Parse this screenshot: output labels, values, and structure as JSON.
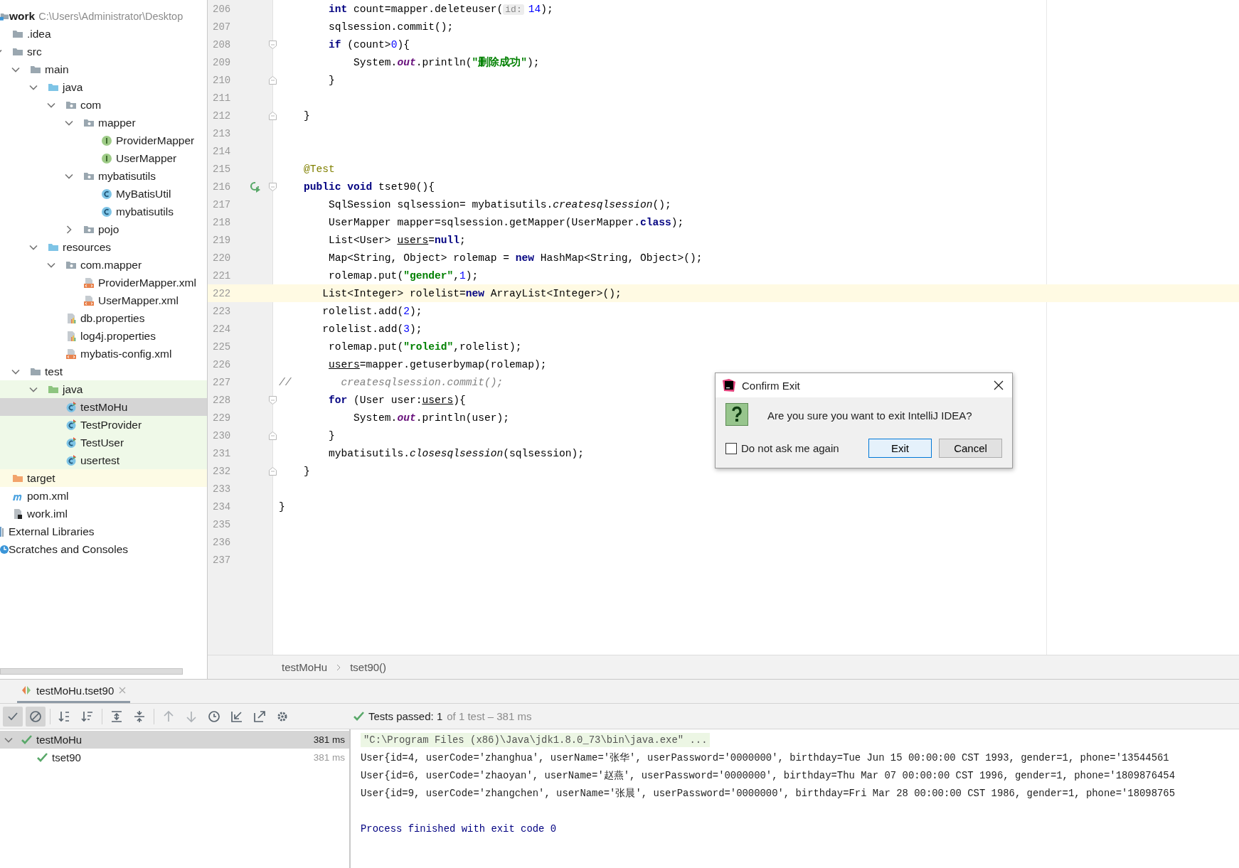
{
  "project": {
    "root": {
      "label": "work",
      "path": "C:\\Users\\Administrator\\Desktop",
      "kind": "module"
    },
    "tree": [
      {
        "label": ".idea",
        "kind": "folder",
        "excluded": false
      },
      {
        "label": "src",
        "kind": "folder",
        "excluded": false,
        "expanded": true,
        "children": [
          {
            "label": "main",
            "kind": "folder",
            "expanded": true,
            "children": [
              {
                "label": "java",
                "kind": "source-folder",
                "expanded": true,
                "children": [
                  {
                    "label": "com",
                    "kind": "package",
                    "expanded": true,
                    "children": [
                      {
                        "label": "mapper",
                        "kind": "package",
                        "expanded": true,
                        "children": [
                          {
                            "label": "ProviderMapper",
                            "kind": "interface"
                          },
                          {
                            "label": "UserMapper",
                            "kind": "interface"
                          }
                        ]
                      },
                      {
                        "label": "mybatisutils",
                        "kind": "package",
                        "expanded": true,
                        "children": [
                          {
                            "label": "MyBatisUtil",
                            "kind": "class"
                          },
                          {
                            "label": "mybatisutils",
                            "kind": "class"
                          }
                        ]
                      },
                      {
                        "label": "pojo",
                        "kind": "package",
                        "expanded": false
                      }
                    ]
                  }
                ]
              },
              {
                "label": "resources",
                "kind": "resources-folder",
                "expanded": true,
                "children": [
                  {
                    "label": "com.mapper",
                    "kind": "package",
                    "expanded": true,
                    "children": [
                      {
                        "label": "ProviderMapper.xml",
                        "kind": "xml"
                      },
                      {
                        "label": "UserMapper.xml",
                        "kind": "xml"
                      }
                    ]
                  },
                  {
                    "label": "db.properties",
                    "kind": "properties"
                  },
                  {
                    "label": "log4j.properties",
                    "kind": "properties"
                  },
                  {
                    "label": "mybatis-config.xml",
                    "kind": "xml"
                  }
                ]
              }
            ]
          },
          {
            "label": "test",
            "kind": "folder",
            "expanded": true,
            "children": [
              {
                "label": "java",
                "kind": "test-folder",
                "test_scope": true,
                "expanded": true,
                "children": [
                  {
                    "label": "testMoHu",
                    "kind": "test-class",
                    "test_scope": true,
                    "selected": true
                  },
                  {
                    "label": "TestProvider",
                    "kind": "test-class",
                    "test_scope": true,
                    "selected": false
                  },
                  {
                    "label": "TestUser",
                    "kind": "test-class",
                    "test_scope": true,
                    "selected": false
                  },
                  {
                    "label": "usertest",
                    "kind": "test-class",
                    "test_scope": true,
                    "selected": false
                  }
                ]
              }
            ]
          }
        ]
      },
      {
        "label": "target",
        "kind": "excluded-folder",
        "excluded": true
      },
      {
        "label": "pom.xml",
        "kind": "maven",
        "excluded": false
      },
      {
        "label": "work.iml",
        "kind": "iml",
        "excluded": false
      }
    ],
    "extras": [
      {
        "label": "External Libraries",
        "kind": "libraries"
      },
      {
        "label": "Scratches and Consoles",
        "kind": "scratches"
      }
    ]
  },
  "editor": {
    "lines": [
      {
        "number": "206",
        "kind": "body",
        "tokens": [
          {
            "keyword": "int"
          },
          {
            "text": " count=mapper.deleteuser("
          },
          {
            "hint": "id:"
          },
          {
            "number": "14"
          },
          {
            "text": ");"
          }
        ]
      },
      {
        "number": "207",
        "kind": "body",
        "tokens": [
          {
            "text": "sqlsession.commit();"
          }
        ]
      },
      {
        "number": "208",
        "kind": "body",
        "fold_start": true,
        "tokens": [
          {
            "keyword": "if"
          },
          {
            "text": " (count>"
          },
          {
            "number": "0"
          },
          {
            "text": "){"
          }
        ]
      },
      {
        "number": "209",
        "kind": "inner",
        "tokens": [
          {
            "text": "System."
          },
          {
            "static_field": "out"
          },
          {
            "text": ".println("
          },
          {
            "string": "\"删除成功\""
          },
          {
            "text": ");"
          }
        ]
      },
      {
        "number": "210",
        "kind": "body",
        "fold_end": true,
        "tokens": [
          {
            "text": "}"
          }
        ]
      },
      {
        "number": "211"
      },
      {
        "number": "212",
        "kind": "method",
        "fold_end": true,
        "tokens": [
          {
            "text": "}"
          }
        ]
      },
      {
        "number": "213"
      },
      {
        "number": "214"
      },
      {
        "number": "215",
        "kind": "method",
        "tokens": [
          {
            "annotation": "@Test"
          }
        ]
      },
      {
        "number": "216",
        "kind": "method",
        "fold_start": true,
        "run": true,
        "tokens": [
          {
            "keyword": "public void"
          },
          {
            "text": " tset90(){"
          }
        ]
      },
      {
        "number": "217",
        "kind": "body",
        "tokens": [
          {
            "text": "SqlSession sqlsession= mybatisutils."
          },
          {
            "italic": "createsqlsession"
          },
          {
            "text": "();"
          }
        ]
      },
      {
        "number": "218",
        "kind": "body",
        "tokens": [
          {
            "text": "UserMapper mapper=sqlsession.getMapper(UserMapper."
          },
          {
            "keyword": "class"
          },
          {
            "text": ");"
          }
        ]
      },
      {
        "number": "219",
        "kind": "body",
        "tokens": [
          {
            "text": "List<User> "
          },
          {
            "underlined": "users"
          },
          {
            "text": "="
          },
          {
            "keyword": "null"
          },
          {
            "text": ";"
          }
        ]
      },
      {
        "number": "220",
        "kind": "body",
        "tokens": [
          {
            "text": "Map<String, Object> rolemap = "
          },
          {
            "keyword": "new"
          },
          {
            "text": " HashMap<String, Object>();"
          }
        ]
      },
      {
        "number": "221",
        "kind": "body",
        "tokens": [
          {
            "text": "rolemap.put("
          },
          {
            "string": "\"gender\""
          },
          {
            "text": ","
          },
          {
            "number": "1"
          },
          {
            "text": ");"
          }
        ]
      },
      {
        "number": "222",
        "kind": "shifted",
        "current": true,
        "tokens": [
          {
            "text": "List<Integer> rolelist="
          },
          {
            "keyword": "new"
          },
          {
            "text": " ArrayList<Integer>();"
          }
        ]
      },
      {
        "number": "223",
        "kind": "shifted",
        "tokens": [
          {
            "text": "rolelist.add("
          },
          {
            "number": "2"
          },
          {
            "text": ");"
          }
        ]
      },
      {
        "number": "224",
        "kind": "shifted",
        "tokens": [
          {
            "text": "rolelist.add("
          },
          {
            "number": "3"
          },
          {
            "text": ");"
          }
        ]
      },
      {
        "number": "225",
        "kind": "body",
        "tokens": [
          {
            "text": "rolemap.put("
          },
          {
            "string": "\"roleid\""
          },
          {
            "text": ",rolelist);"
          }
        ]
      },
      {
        "number": "226",
        "kind": "body",
        "tokens": [
          {
            "underlined": "users"
          },
          {
            "text": "=mapper.getuserbymap(rolemap);"
          }
        ]
      },
      {
        "number": "227",
        "kind": "flush",
        "tokens": [
          {
            "comment": "//        createsqlsession.commit();"
          }
        ]
      },
      {
        "number": "228",
        "kind": "body",
        "fold_start": true,
        "tokens": [
          {
            "keyword": "for"
          },
          {
            "text": " (User user:"
          },
          {
            "underlined": "users"
          },
          {
            "text": "){"
          }
        ]
      },
      {
        "number": "229",
        "kind": "inner",
        "tokens": [
          {
            "text": "System."
          },
          {
            "static_field": "out"
          },
          {
            "text": ".println(user);"
          }
        ]
      },
      {
        "number": "230",
        "kind": "body",
        "fold_end": true,
        "tokens": [
          {
            "text": "}"
          }
        ]
      },
      {
        "number": "231",
        "kind": "body",
        "tokens": [
          {
            "text": "mybatisutils."
          },
          {
            "italic": "closesqlsession"
          },
          {
            "text": "(sqlsession);"
          }
        ]
      },
      {
        "number": "232",
        "kind": "method",
        "fold_end": true,
        "tokens": [
          {
            "text": "}"
          }
        ]
      },
      {
        "number": "233"
      },
      {
        "number": "234",
        "kind": "flush",
        "tokens": [
          {
            "text": "}"
          }
        ]
      },
      {
        "number": "235"
      },
      {
        "number": "236"
      },
      {
        "number": "237"
      }
    ],
    "breadcrumbs": [
      "testMoHu",
      "tset90()"
    ]
  },
  "dialog": {
    "title": "Confirm Exit",
    "message": "Are you sure you want to exit IntelliJ IDEA?",
    "checkbox": {
      "label": "Do not ask me again",
      "checked": false
    },
    "buttons": [
      {
        "label": "Exit",
        "default": true
      },
      {
        "label": "Cancel",
        "default": false
      }
    ]
  },
  "run": {
    "tab": {
      "label": "testMoHu.tset90",
      "selected": true
    },
    "toolbar": [
      {
        "kind": "check",
        "pressed": true,
        "disabled": false
      },
      {
        "kind": "stop",
        "pressed": true,
        "disabled": false
      },
      {
        "kind": "sort-alpha",
        "pressed": false,
        "disabled": false
      },
      {
        "kind": "sort-duration",
        "pressed": false,
        "disabled": false
      },
      {
        "kind": "expand",
        "pressed": false,
        "disabled": false
      },
      {
        "kind": "collapse",
        "pressed": false,
        "disabled": false
      },
      {
        "kind": "up",
        "pressed": false,
        "disabled": true
      },
      {
        "kind": "down",
        "pressed": false,
        "disabled": true
      },
      {
        "kind": "history",
        "pressed": false,
        "disabled": false
      },
      {
        "kind": "import",
        "pressed": false,
        "disabled": false
      },
      {
        "kind": "export",
        "pressed": false,
        "disabled": false
      },
      {
        "kind": "settings",
        "pressed": false,
        "disabled": false
      }
    ],
    "status": {
      "label": "Tests passed: 1",
      "detail": "of 1 test – 381 ms"
    },
    "tests": [
      {
        "label": "testMoHu",
        "time": "381 ms",
        "passed": true,
        "selected": true,
        "expanded": true,
        "children": [
          {
            "label": "tset90",
            "time": "381 ms",
            "passed": true,
            "selected": false
          }
        ]
      }
    ],
    "console": [
      {
        "kind": "command",
        "text": "\"C:\\Program Files (x86)\\Java\\jdk1.8.0_73\\bin\\java.exe\" ..."
      },
      {
        "kind": "output",
        "text": "User{id=4, userCode='zhanghua', userName='张华', userPassword='0000000', birthday=Tue Jun 15 00:00:00 CST 1993, gender=1, phone='13544561"
      },
      {
        "kind": "output",
        "text": "User{id=6, userCode='zhaoyan', userName='赵燕', userPassword='0000000', birthday=Thu Mar 07 00:00:00 CST 1996, gender=1, phone='1809876454"
      },
      {
        "kind": "output",
        "text": "User{id=9, userCode='zhangchen', userName='张晨', userPassword='0000000', birthday=Fri Mar 28 00:00:00 CST 1986, gender=1, phone='18098765"
      },
      {
        "kind": "exit",
        "text": "Process finished with exit code 0"
      }
    ]
  }
}
